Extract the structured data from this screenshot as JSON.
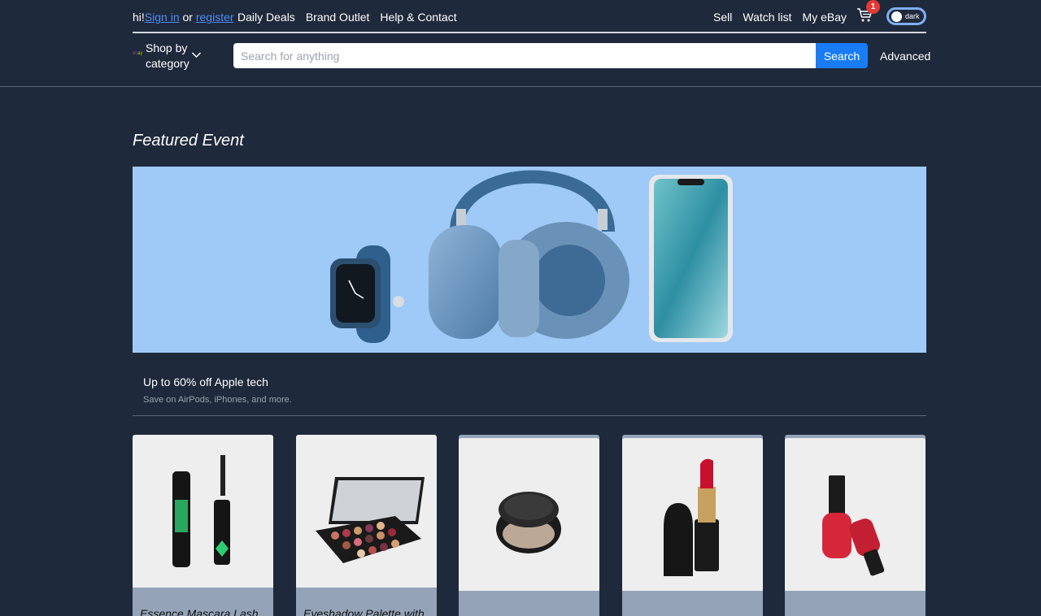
{
  "header": {
    "greeting": "hi!",
    "sign_in": "Sign in",
    "or": "or",
    "register": "register",
    "nav_left": [
      "Daily Deals",
      "Brand Outlet",
      "Help & Contact"
    ],
    "nav_right": [
      "Sell",
      "Watch list",
      "My eBay"
    ],
    "cart_count": "1",
    "theme_toggle_label": "dark",
    "logo_letters": [
      "e",
      "b",
      "a",
      "y"
    ]
  },
  "search": {
    "shop_by_category": "Shop by category",
    "placeholder": "Search for anything",
    "button_label": "Search",
    "advanced_label": "Advanced"
  },
  "featured": {
    "title": "Featured Event",
    "promo_title": "Up to 60% off Apple tech",
    "promo_subtitle": "Save on AirPods, iPhones, and more."
  },
  "products": [
    {
      "title": "Essence Mascara Lash",
      "image": "mascara"
    },
    {
      "title": "Eyeshadow Palette with",
      "image": "eyeshadow-palette"
    },
    {
      "title": "",
      "image": "powder-compact"
    },
    {
      "title": "",
      "image": "lipstick"
    },
    {
      "title": "",
      "image": "nail-polish"
    }
  ],
  "colors": {
    "background": "#1e293b",
    "accent": "#1a7cf5",
    "banner": "#9fc9f7",
    "card": "#94a3b8",
    "badge": "#e53935"
  }
}
